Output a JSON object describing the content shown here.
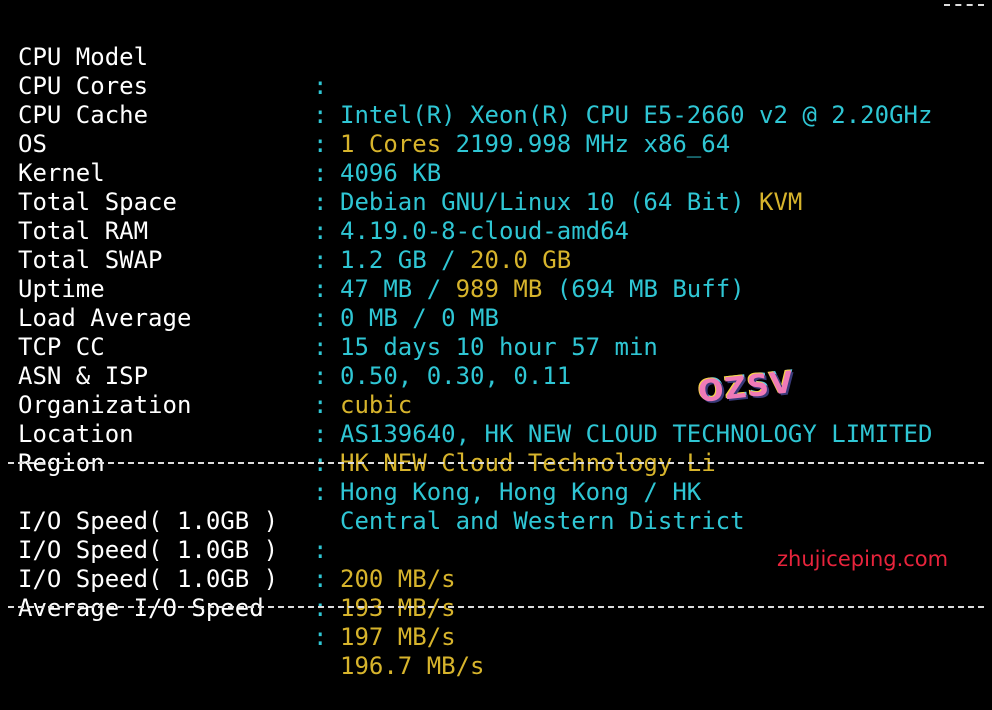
{
  "rows": [
    {
      "label": "CPU Model",
      "colon": ":",
      "parts": [
        "Intel(R) Xeon(R) CPU E5-2660 v2 @ 2.20GHz"
      ]
    },
    {
      "label": "CPU Cores",
      "colon": ":",
      "parts": [
        "1 Cores",
        " 2199.998 MHz x86_64"
      ]
    },
    {
      "label": "CPU Cache",
      "colon": ":",
      "parts": [
        "4096 KB"
      ]
    },
    {
      "label": "OS",
      "colon": ":",
      "parts": [
        "Debian GNU/Linux 10 (64 Bit)",
        " KVM"
      ]
    },
    {
      "label": "Kernel",
      "colon": ":",
      "parts": [
        "4.19.0-8-cloud-amd64"
      ]
    },
    {
      "label": "Total Space",
      "colon": ":",
      "parts": [
        "1.2 GB / ",
        "20.0 GB"
      ]
    },
    {
      "label": "Total RAM",
      "colon": ":",
      "parts": [
        "47 MB / ",
        "989 MB",
        " (694 MB Buff)"
      ]
    },
    {
      "label": "Total SWAP",
      "colon": ":",
      "parts": [
        "0 MB / 0 MB"
      ]
    },
    {
      "label": "Uptime",
      "colon": ":",
      "parts": [
        "15 days 10 hour 57 min"
      ]
    },
    {
      "label": "Load Average",
      "colon": ":",
      "parts": [
        "0.50, 0.30, 0.11"
      ]
    },
    {
      "label": "TCP CC",
      "colon": ":",
      "parts": [
        "cubic"
      ]
    },
    {
      "label": "ASN & ISP",
      "colon": ":",
      "parts": [
        "AS139640, HK NEW CLOUD TECHNOLOGY LIMITED"
      ]
    },
    {
      "label": "Organization",
      "colon": ":",
      "parts": [
        "HK NEW Cloud Technology Li"
      ]
    },
    {
      "label": "Location",
      "colon": ":",
      "parts": [
        "Hong Kong, Hong Kong / HK"
      ]
    },
    {
      "label": "Region",
      "colon": ":",
      "parts": [
        "Central and Western District"
      ]
    }
  ],
  "io_rows": [
    {
      "label": "I/O Speed( 1.0GB )",
      "colon": ":",
      "parts": [
        "200 MB/s"
      ]
    },
    {
      "label": "I/O Speed( 1.0GB )",
      "colon": ":",
      "parts": [
        "193 MB/s"
      ]
    },
    {
      "label": "I/O Speed( 1.0GB )",
      "colon": ":",
      "parts": [
        "197 MB/s"
      ]
    },
    {
      "label": "Average I/O Speed",
      "colon": ":",
      "parts": [
        "196.7 MB/s"
      ]
    }
  ],
  "watermark": {
    "logo_text": "OZSV",
    "site_text": "zhujiceping.com"
  },
  "colors": {
    "background": "#000000",
    "label": "#ffffff",
    "cyan": "#2fc6d4",
    "yellow": "#d7b42c",
    "watermark_red": "#e8243c"
  }
}
